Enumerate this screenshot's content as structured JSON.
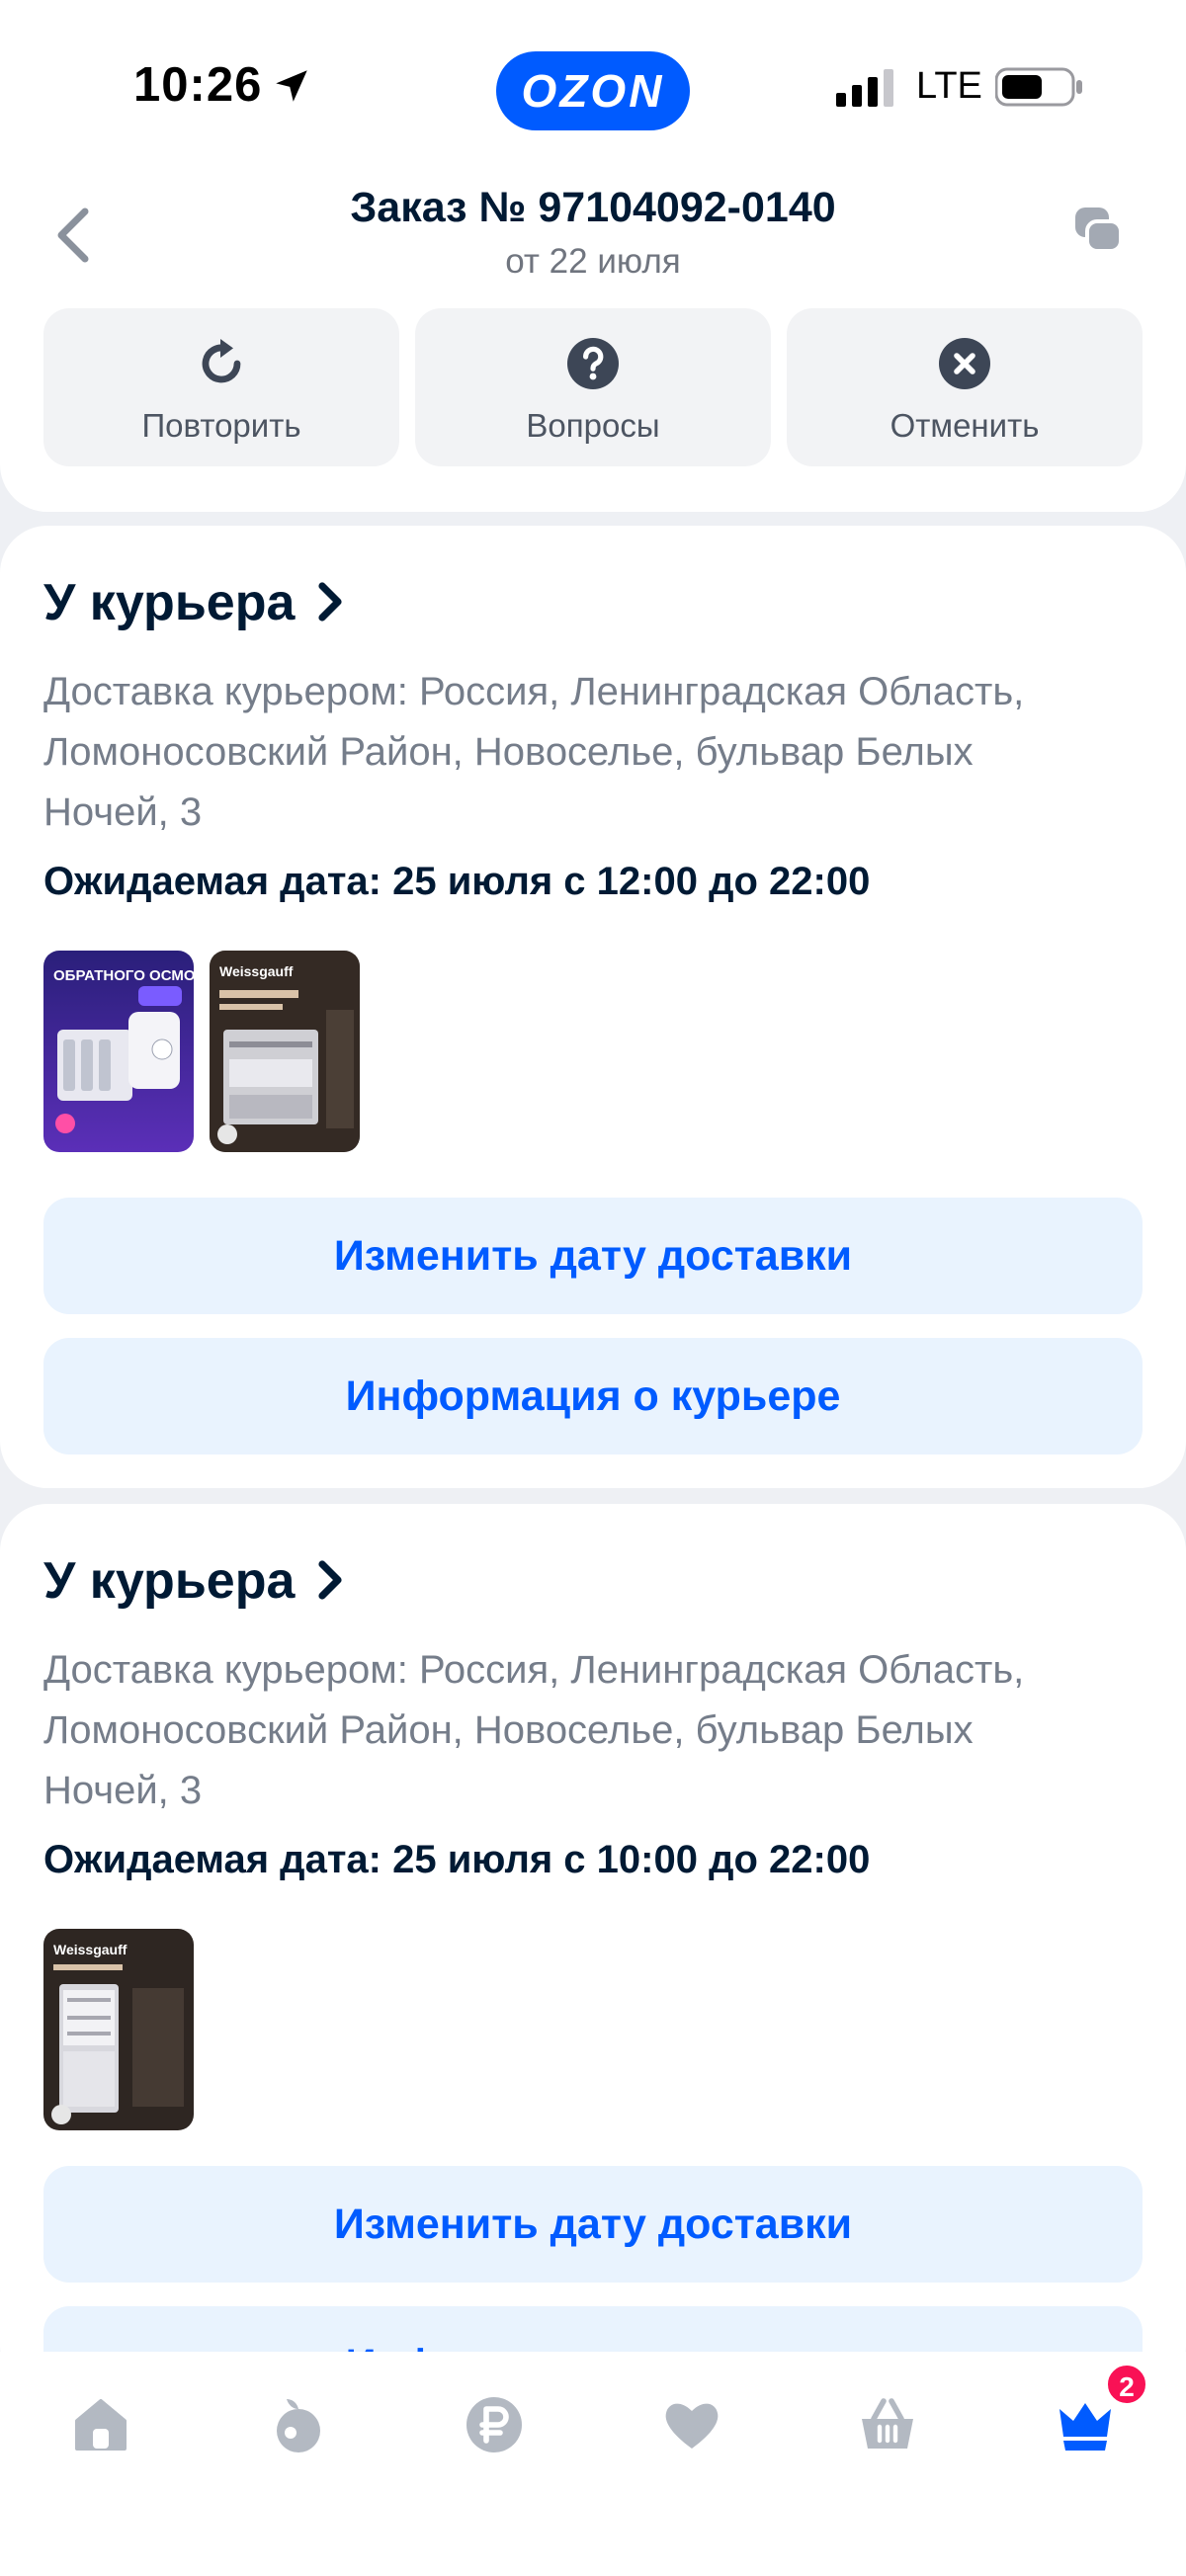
{
  "status_bar": {
    "time": "10:26",
    "brand": "OZON",
    "network": "LTE"
  },
  "header": {
    "title": "Заказ № 97104092-0140",
    "subtitle": "от 22 июля"
  },
  "actions": [
    {
      "label": "Повторить",
      "icon": "repeat-icon"
    },
    {
      "label": "Вопросы",
      "icon": "question-icon"
    },
    {
      "label": "Отменить",
      "icon": "cancel-icon"
    }
  ],
  "shipments": [
    {
      "status": "У курьера",
      "address": "Доставка курьером: Россия, Ленинградская Область, Ломоносовский Район, Новоселье, бульвар Белых Ночей, 3",
      "expected": "Ожидаемая дата: 25 июля с 12:00 до 22:00",
      "products": [
        {
          "name": "water-filter-product",
          "badge": "ОБРАТНОГО ОСМОСА"
        },
        {
          "name": "dishwasher-product",
          "badge": "Weissgauff"
        }
      ],
      "buttons": [
        "Изменить дату доставки",
        "Информация о курьере"
      ]
    },
    {
      "status": "У курьера",
      "address": "Доставка курьером: Россия, Ленинградская Область, Ломоносовский Район, Новоселье, бульвар Белых Ночей, 3",
      "expected": "Ожидаемая дата: 25 июля с 10:00 до 22:00",
      "products": [
        {
          "name": "refrigerator-product",
          "badge": "Weissgauff"
        }
      ],
      "buttons": [
        "Изменить дату доставки",
        "Информация о курьере"
      ]
    }
  ],
  "tab_bar": {
    "tabs": [
      "home-icon",
      "fresh-icon",
      "finance-icon",
      "favorites-icon",
      "cart-icon",
      "profile-icon"
    ],
    "badge": "2"
  },
  "colors": {
    "accent": "#005bff",
    "button_bg": "#e9f3fe",
    "badge": "#f91155",
    "muted_text": "#757d8a"
  }
}
